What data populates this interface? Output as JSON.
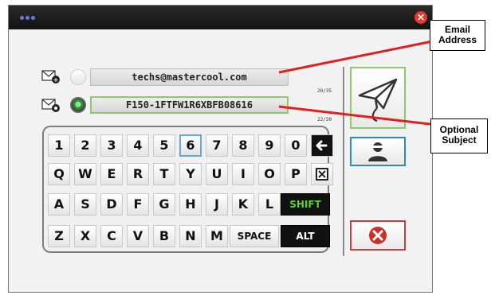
{
  "email": {
    "value": "techs@mastercool.com",
    "counter": "20/35"
  },
  "subject": {
    "value": "F150-1FTFW1R6XBFB08616",
    "counter": "22/30"
  },
  "keyboard": {
    "row1": [
      "1",
      "2",
      "3",
      "4",
      "5",
      "6",
      "7",
      "8",
      "9",
      "0"
    ],
    "row2": [
      "Q",
      "W",
      "E",
      "R",
      "T",
      "Y",
      "U",
      "I",
      "O",
      "P"
    ],
    "row3": [
      "A",
      "S",
      "D",
      "F",
      "G",
      "H",
      "J",
      "K",
      "L"
    ],
    "row4": [
      "Z",
      "X",
      "C",
      "V",
      "B",
      "N",
      "M"
    ],
    "shift": "SHIFT",
    "space": "SPACE",
    "alt": "ALT",
    "selected_key": "6"
  },
  "callouts": {
    "email": "Email Address",
    "subject": "Optional Subject"
  },
  "colors": {
    "title_bar": "#1a1a1a",
    "close": "#e23a2e",
    "accent_green": "#8fc86b",
    "shift_text": "#5bd12d",
    "callout_line": "#e02020",
    "contact_border": "#2c8fb0",
    "cancel_border": "#c44040"
  }
}
